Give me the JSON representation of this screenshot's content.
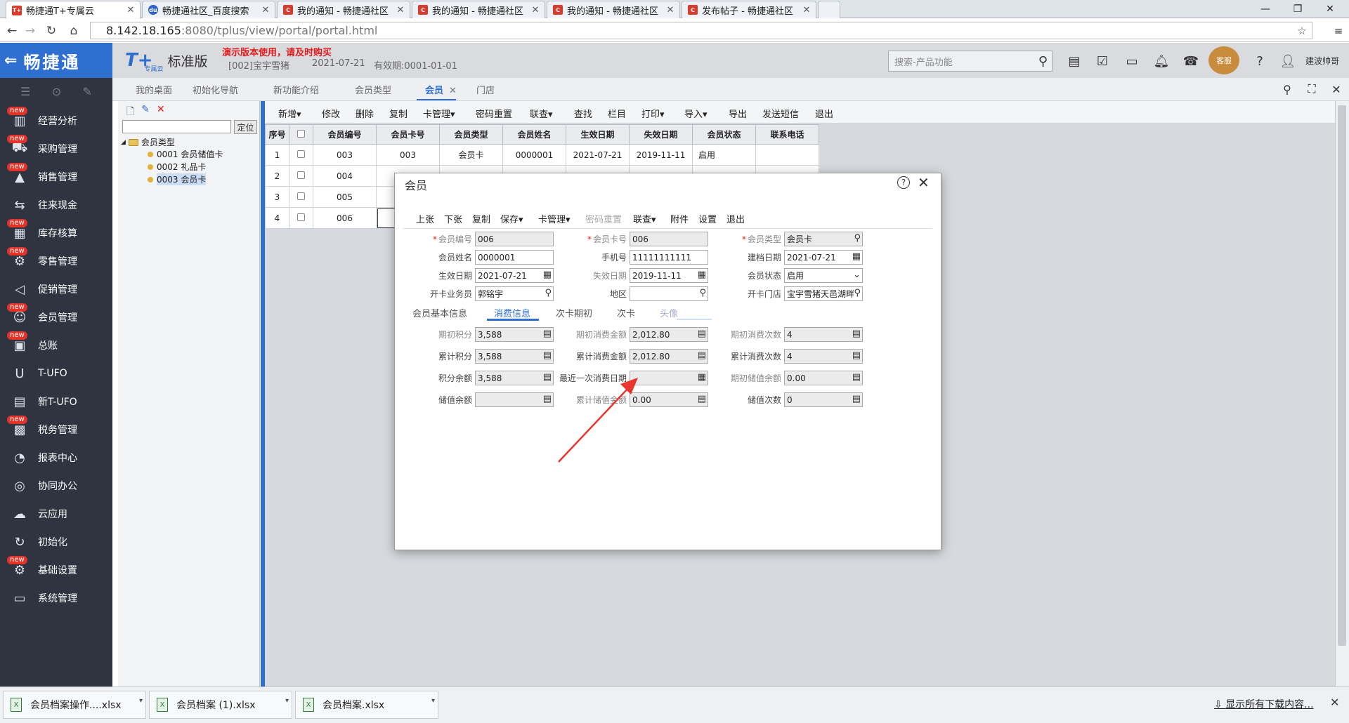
{
  "browser": {
    "tabs": [
      {
        "label": "畅捷通T+专属云",
        "icon": "tplus-favicon",
        "active": true
      },
      {
        "label": "畅捷通社区_百度搜索",
        "icon": "baidu-favicon"
      },
      {
        "label": "我的通知 - 畅捷通社区",
        "icon": "chanjet-favicon"
      },
      {
        "label": "我的通知 - 畅捷通社区",
        "icon": "chanjet-favicon"
      },
      {
        "label": "我的通知 - 畅捷通社区",
        "icon": "chanjet-favicon"
      },
      {
        "label": "发布帖子 - 畅捷通社区",
        "icon": "chanjet-favicon"
      }
    ],
    "url_host": "8.142.18.165",
    "url_rest": ":8080/tplus/view/portal/portal.html"
  },
  "header": {
    "logo": "畅捷通",
    "brand": "T+",
    "brand_sub": "专属云",
    "edition": "标准版",
    "demo_notice": "演示版本使用，请及时购买",
    "account": "[002]宝宇雪猪",
    "date": "2021-07-21",
    "validity": "有效期:0001-01-01",
    "search_placeholder": "搜索-产品功能",
    "mascot": "客服",
    "username": "建波帅哥"
  },
  "sidebar": {
    "items": [
      {
        "label": "经营分析",
        "icon": "analytics-icon",
        "new": true
      },
      {
        "label": "采购管理",
        "icon": "purchase-icon",
        "new": true
      },
      {
        "label": "销售管理",
        "icon": "sales-icon",
        "new": true
      },
      {
        "label": "往来现金",
        "icon": "cash-icon",
        "new": false
      },
      {
        "label": "库存核算",
        "icon": "inventory-icon",
        "new": true
      },
      {
        "label": "零售管理",
        "icon": "retail-icon",
        "new": true
      },
      {
        "label": "促销管理",
        "icon": "promotion-icon",
        "new": false
      },
      {
        "label": "会员管理",
        "icon": "member-icon",
        "new": true
      },
      {
        "label": "总账",
        "icon": "ledger-icon",
        "new": true
      },
      {
        "label": "T-UFO",
        "icon": "ufo-icon",
        "new": false
      },
      {
        "label": "新T-UFO",
        "icon": "new-ufo-icon",
        "new": false
      },
      {
        "label": "税务管理",
        "icon": "tax-icon",
        "new": true
      },
      {
        "label": "报表中心",
        "icon": "report-icon",
        "new": false
      },
      {
        "label": "协同办公",
        "icon": "office-icon",
        "new": false
      },
      {
        "label": "云应用",
        "icon": "cloud-icon",
        "new": false
      },
      {
        "label": "初始化",
        "icon": "init-icon",
        "new": false
      },
      {
        "label": "基础设置",
        "icon": "settings-icon",
        "new": true
      },
      {
        "label": "系统管理",
        "icon": "system-icon",
        "new": false
      }
    ],
    "new_badge": "new"
  },
  "content_tabs": [
    "我的桌面",
    "初始化导航",
    "新功能介绍",
    "会员类型",
    "会员",
    "门店"
  ],
  "tree": {
    "locate": "定位",
    "root": "会员类型",
    "children": [
      "0001 会员储值卡",
      "0002 礼品卡",
      "0003 会员卡"
    ]
  },
  "toolbar": [
    "新增",
    "修改",
    "删除",
    "复制",
    "卡管理",
    "密码重置",
    "联查",
    "查找",
    "栏目",
    "打印",
    "导入",
    "导出",
    "发送短信",
    "退出"
  ],
  "grid": {
    "headers": [
      "序号",
      "",
      "会员编号",
      "会员卡号",
      "会员类型",
      "会员姓名",
      "生效日期",
      "失效日期",
      "会员状态",
      "联系电话"
    ],
    "rows": [
      [
        "1",
        "",
        "003",
        "003",
        "会员卡",
        "0000001",
        "2021-07-21",
        "2019-11-11",
        "启用",
        ""
      ],
      [
        "2",
        "",
        "004",
        "",
        "",
        "",
        "",
        "",
        "",
        ""
      ],
      [
        "3",
        "",
        "005",
        "",
        "",
        "",
        "",
        "",
        "",
        ""
      ],
      [
        "4",
        "",
        "006",
        "",
        "",
        "",
        "",
        "",
        "",
        ""
      ]
    ]
  },
  "downloads": {
    "items": [
      "会员档案操作....xlsx",
      "会员档案 (1).xlsx",
      "会员档案.xlsx"
    ],
    "show_all": "显示所有下载内容..."
  },
  "modal": {
    "title": "会员",
    "toolbar": [
      "上张",
      "下张",
      "复制",
      "保存",
      "卡管理",
      "密码重置",
      "联查",
      "附件",
      "设置",
      "退出"
    ],
    "fields": {
      "member_no": {
        "label": "会员编号",
        "value": "006"
      },
      "card_no": {
        "label": "会员卡号",
        "value": "006"
      },
      "member_type": {
        "label": "会员类型",
        "value": "会员卡"
      },
      "name": {
        "label": "会员姓名",
        "value": "0000001"
      },
      "phone": {
        "label": "手机号",
        "value": "11111111111"
      },
      "created": {
        "label": "建档日期",
        "value": "2021-07-21"
      },
      "effective": {
        "label": "生效日期",
        "value": "2021-07-21"
      },
      "expire": {
        "label": "失效日期",
        "value": "2019-11-11"
      },
      "status": {
        "label": "会员状态",
        "value": "启用"
      },
      "agent": {
        "label": "开卡业务员",
        "value": "郭铭宇"
      },
      "region": {
        "label": "地区",
        "value": ""
      },
      "store": {
        "label": "开卡门店",
        "value": "宝宇雪猪天邑湖畔"
      }
    },
    "subtabs": [
      "会员基本信息",
      "消费信息",
      "次卡期初",
      "次卡",
      "头像"
    ],
    "consume": {
      "init_points": {
        "label": "期初积分",
        "value": "3,588"
      },
      "init_amount": {
        "label": "期初消费金额",
        "value": "2,012.80"
      },
      "init_count": {
        "label": "期初消费次数",
        "value": "4"
      },
      "total_points": {
        "label": "累计积分",
        "value": "3,588"
      },
      "total_amount": {
        "label": "累计消费金额",
        "value": "2,012.80"
      },
      "total_count": {
        "label": "累计消费次数",
        "value": "4"
      },
      "points_balance": {
        "label": "积分余额",
        "value": "3,588"
      },
      "last_date": {
        "label": "最近一次消费日期",
        "value": ""
      },
      "init_stored": {
        "label": "期初储值余额",
        "value": "0.00"
      },
      "stored_balance": {
        "label": "储值余额",
        "value": ""
      },
      "total_stored": {
        "label": "累计储值金额",
        "value": "0.00"
      },
      "stored_count": {
        "label": "储值次数",
        "value": "0"
      }
    }
  },
  "colors": {
    "accent": "#2e6fd0",
    "sidebar": "#2e3440",
    "badge": "#e4342a",
    "annotation_arrow": "#e8352d"
  }
}
